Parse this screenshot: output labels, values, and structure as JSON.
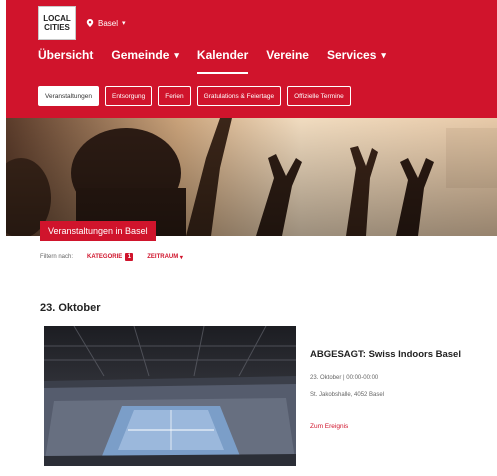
{
  "header": {
    "logo_line1": "LOCAL",
    "logo_line2": "CITIES",
    "city": "Basel",
    "nav": [
      {
        "label": "Übersicht",
        "has_dropdown": false
      },
      {
        "label": "Gemeinde",
        "has_dropdown": true
      },
      {
        "label": "Kalender",
        "has_dropdown": false,
        "active": true
      },
      {
        "label": "Vereine",
        "has_dropdown": false
      },
      {
        "label": "Services",
        "has_dropdown": true
      }
    ],
    "subnav": [
      {
        "label": "Veranstaltungen",
        "active": true
      },
      {
        "label": "Entsorgung"
      },
      {
        "label": "Ferien"
      },
      {
        "label": "Gratulations & Feiertage"
      },
      {
        "label": "Offizielle Termine"
      }
    ]
  },
  "hero": {
    "title": "Veranstaltungen in Basel"
  },
  "filters": {
    "label": "Filtern nach:",
    "category": "KATEGORIE",
    "category_count": "1",
    "date": "ZEITRAUM"
  },
  "event": {
    "date_heading": "23. Oktober",
    "title": "ABGESAGT: Swiss Indoors Basel",
    "when": "23. Oktober | 00:00-00:00",
    "where": "St. Jakobshalle, 4052 Basel",
    "link": "Zum Ereignis"
  },
  "colors": {
    "brand_red": "#d0142c",
    "court_blue": "#7b9ec8"
  },
  "icons": {
    "city_pin": "location-pin-icon",
    "dropdown": "chevron-down-icon"
  }
}
